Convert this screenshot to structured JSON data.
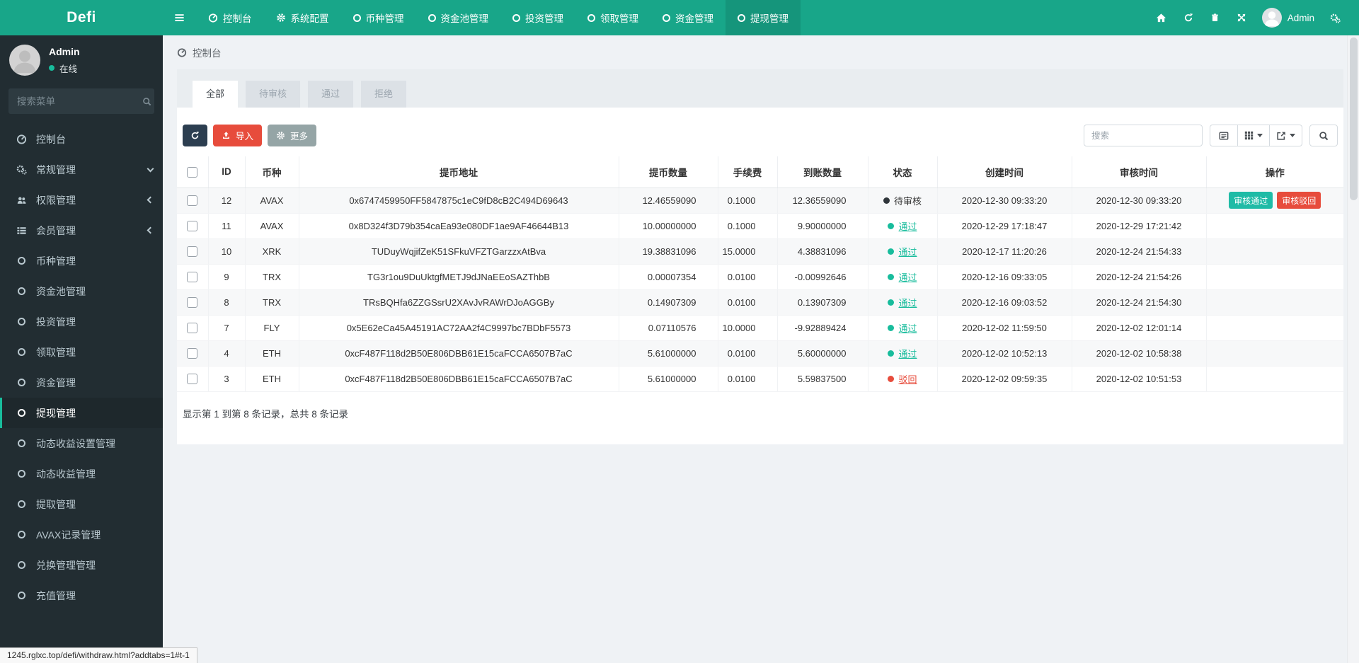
{
  "navbar": {
    "logo": "Defi",
    "items": [
      {
        "label": "控制台",
        "icon": "dashboard"
      },
      {
        "label": "系统配置",
        "icon": "gear"
      },
      {
        "label": "币种管理",
        "icon": "circle"
      },
      {
        "label": "资金池管理",
        "icon": "circle"
      },
      {
        "label": "投资管理",
        "icon": "circle"
      },
      {
        "label": "领取管理",
        "icon": "circle"
      },
      {
        "label": "资金管理",
        "icon": "circle"
      },
      {
        "label": "提现管理",
        "icon": "circle",
        "active": true
      }
    ],
    "admin_label": "Admin"
  },
  "sidebar": {
    "user": {
      "name": "Admin",
      "status": "在线"
    },
    "search_placeholder": "搜索菜单",
    "items": [
      {
        "label": "控制台",
        "icon": "dashboard"
      },
      {
        "label": "常规管理",
        "icon": "gears",
        "chevron": "down"
      },
      {
        "label": "权限管理",
        "icon": "users",
        "chevron": "left"
      },
      {
        "label": "会员管理",
        "icon": "list",
        "chevron": "left"
      },
      {
        "label": "币种管理",
        "icon": "circle"
      },
      {
        "label": "资金池管理",
        "icon": "circle"
      },
      {
        "label": "投资管理",
        "icon": "circle"
      },
      {
        "label": "领取管理",
        "icon": "circle"
      },
      {
        "label": "资金管理",
        "icon": "circle"
      },
      {
        "label": "提现管理",
        "icon": "circle",
        "active": true
      },
      {
        "label": "动态收益设置管理",
        "icon": "circle"
      },
      {
        "label": "动态收益管理",
        "icon": "circle"
      },
      {
        "label": "提取管理",
        "icon": "circle"
      },
      {
        "label": "AVAX记录管理",
        "icon": "circle"
      },
      {
        "label": "兑换管理管理",
        "icon": "circle"
      },
      {
        "label": "充值管理",
        "icon": "circle"
      }
    ]
  },
  "breadcrumb": {
    "label": "控制台"
  },
  "tabs": [
    {
      "label": "全部",
      "active": true
    },
    {
      "label": "待审核"
    },
    {
      "label": "通过"
    },
    {
      "label": "拒绝"
    }
  ],
  "toolbar": {
    "import_label": "导入",
    "more_label": "更多",
    "search_placeholder": "搜索"
  },
  "table": {
    "headers": [
      "ID",
      "币种",
      "提币地址",
      "提币数量",
      "手续费",
      "到账数量",
      "状态",
      "创建时间",
      "审核时间",
      "操作"
    ],
    "actions": {
      "approve": "审核通过",
      "reject": "审核驳回"
    },
    "rows": [
      {
        "id": "12",
        "coin": "AVAX",
        "address": "0x6747459950FF5847875c1eC9fD8cB2C494D69643",
        "amount": "12.46559090",
        "fee": "0.1000",
        "receive": "12.36559090",
        "status": "待审核",
        "created": "2020-12-30 09:33:20",
        "audited": "2020-12-30 09:33:20"
      },
      {
        "id": "11",
        "coin": "AVAX",
        "address": "0x8D324f3D79b354caEa93e080DF1ae9AF46644B13",
        "amount": "10.00000000",
        "fee": "0.1000",
        "receive": "9.90000000",
        "status": "通过",
        "created": "2020-12-29 17:18:47",
        "audited": "2020-12-29 17:21:42"
      },
      {
        "id": "10",
        "coin": "XRK",
        "address": "TUDuyWqjifZeK51SFkuVFZTGarzzxAtBva",
        "amount": "19.38831096",
        "fee": "15.0000",
        "receive": "4.38831096",
        "status": "通过",
        "created": "2020-12-17 11:20:26",
        "audited": "2020-12-24 21:54:33"
      },
      {
        "id": "9",
        "coin": "TRX",
        "address": "TG3r1ou9DuUktgfMETJ9dJNaEEoSAZThbB",
        "amount": "0.00007354",
        "fee": "0.0100",
        "receive": "-0.00992646",
        "status": "通过",
        "created": "2020-12-16 09:33:05",
        "audited": "2020-12-24 21:54:26"
      },
      {
        "id": "8",
        "coin": "TRX",
        "address": "TRsBQHfa6ZZGSsrU2XAvJvRAWrDJoAGGBy",
        "amount": "0.14907309",
        "fee": "0.0100",
        "receive": "0.13907309",
        "status": "通过",
        "created": "2020-12-16 09:03:52",
        "audited": "2020-12-24 21:54:30"
      },
      {
        "id": "7",
        "coin": "FLY",
        "address": "0x5E62eCa45A45191AC72AA2f4C9997bc7BDbF5573",
        "amount": "0.07110576",
        "fee": "10.0000",
        "receive": "-9.92889424",
        "status": "通过",
        "created": "2020-12-02 11:59:50",
        "audited": "2020-12-02 12:01:14"
      },
      {
        "id": "4",
        "coin": "ETH",
        "address": "0xcF487F118d2B50E806DBB61E15caFCCA6507B7aC",
        "amount": "5.61000000",
        "fee": "0.0100",
        "receive": "5.60000000",
        "status": "通过",
        "created": "2020-12-02 10:52:13",
        "audited": "2020-12-02 10:58:38"
      },
      {
        "id": "3",
        "coin": "ETH",
        "address": "0xcF487F118d2B50E806DBB61E15caFCCA6507B7aC",
        "amount": "5.61000000",
        "fee": "0.0100",
        "receive": "5.59837500",
        "status": "驳回",
        "created": "2020-12-02 09:59:35",
        "audited": "2020-12-02 10:51:53"
      }
    ],
    "summary": "显示第 1 到第 8 条记录，总共 8 条记录"
  },
  "statusbar": {
    "url": "1245.rglxc.top/defi/withdraw.html?addtabs=1#t-1"
  },
  "colors": {
    "navbar": "#18A689",
    "sidebar": "#222D32",
    "accent": "#18BC9C",
    "danger": "#E74C3C",
    "dark_button": "#2C3E50",
    "gray_button": "#95A5A6"
  }
}
